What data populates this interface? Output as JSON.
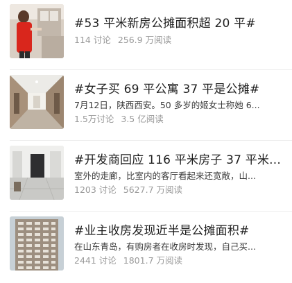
{
  "topics": [
    {
      "title": "#53 平米新房公摊面积超 20 平#",
      "summary": "",
      "discussions": "114 讨论",
      "reads": "256.9 万阅读",
      "thumb_icon": "person-in-kitchen-photo"
    },
    {
      "title": "#女子买 69 平公寓 37 平是公摊#",
      "summary": "7月12日，陕西西安。50 多岁的姬女士称她 6...",
      "discussions": "1.5万讨论",
      "reads": "3.5 亿阅读",
      "thumb_icon": "hallway-photo"
    },
    {
      "title": "#开发商回应 116 平米房子 37 平米...",
      "summary": "室外的走廊，比室内的客厅看起来还宽敞，山...",
      "discussions": "1203 讨论",
      "reads": "5627.7 万阅读",
      "thumb_icon": "empty-room-photo"
    },
    {
      "title": "#业主收房发现近半是公摊面积#",
      "summary": "在山东青岛，有购房者在收房时发现，自己买...",
      "discussions": "2441 讨论",
      "reads": "1801.7 万阅读",
      "thumb_icon": "apartment-tower-photo"
    }
  ]
}
